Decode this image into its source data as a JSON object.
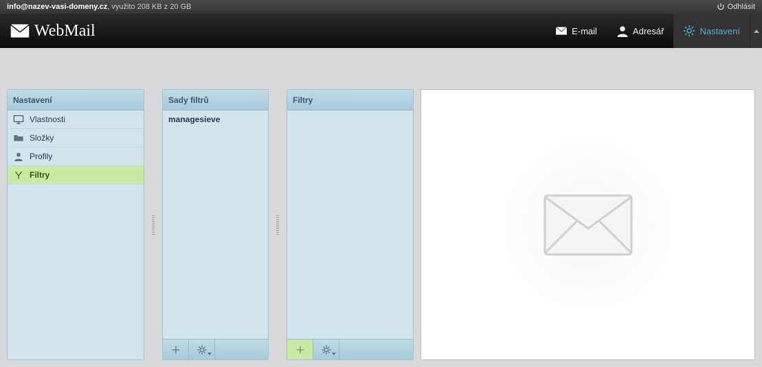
{
  "status": {
    "email": "info@nazev-vasi-domeny.cz",
    "usage_text": ", využito 208 KB z 20 GB",
    "logout": "Odhlásit"
  },
  "header": {
    "logo_text": "WebMail",
    "nav": {
      "email": "E-mail",
      "addressbook": "Adresář",
      "settings": "Nastavení"
    }
  },
  "panels": {
    "settings": {
      "title": "Nastavení",
      "items": [
        {
          "label": "Vlastnosti"
        },
        {
          "label": "Složky"
        },
        {
          "label": "Profily"
        },
        {
          "label": "Filtry"
        }
      ]
    },
    "sets": {
      "title": "Sady filtrů",
      "items": [
        {
          "label": "managesieve"
        }
      ]
    },
    "filters": {
      "title": "Filtry"
    }
  }
}
